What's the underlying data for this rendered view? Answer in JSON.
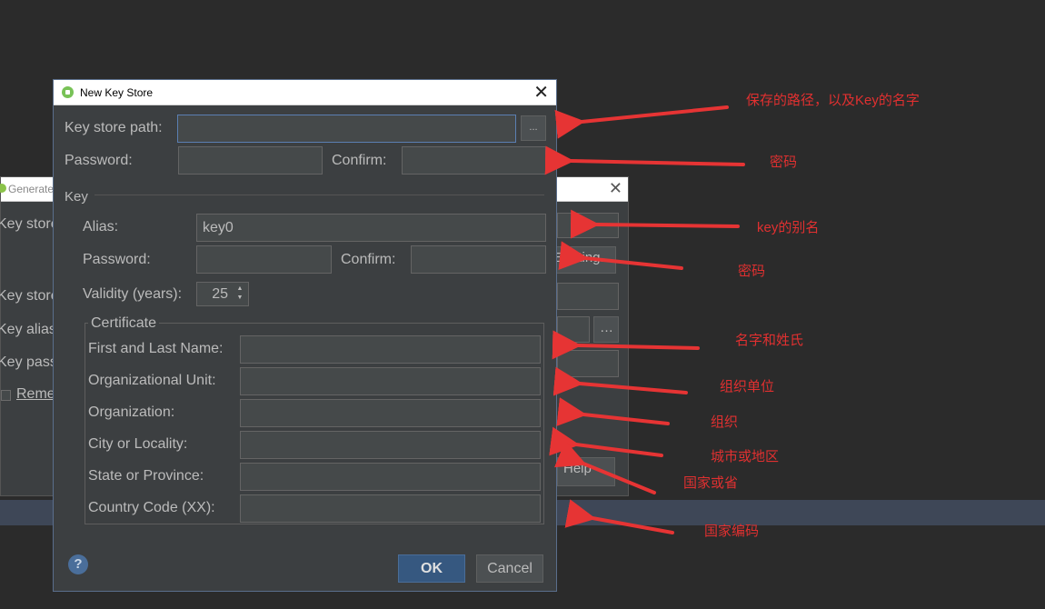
{
  "background_dialog": {
    "title": "Generate",
    "labels": [
      "Key store",
      "Key store",
      "Key alias",
      "Key passw",
      "Reme"
    ],
    "buttons": [
      "Existing...",
      "Help"
    ]
  },
  "dialog": {
    "title": "New Key Store",
    "key_store_path": {
      "label": "Key store path:",
      "value": "",
      "browse": "..."
    },
    "password": {
      "label": "Password:",
      "value": ""
    },
    "confirm": {
      "label": "Confirm:",
      "value": ""
    },
    "key_section": "Key",
    "alias": {
      "label": "Alias:",
      "value": "key0"
    },
    "key_password": {
      "label": "Password:",
      "value": ""
    },
    "key_confirm": {
      "label": "Confirm:",
      "value": ""
    },
    "validity": {
      "label": "Validity (years):",
      "value": "25"
    },
    "certificate": {
      "title": "Certificate",
      "fields": [
        {
          "label": "First and Last Name:",
          "value": ""
        },
        {
          "label": "Organizational Unit:",
          "value": ""
        },
        {
          "label": "Organization:",
          "value": ""
        },
        {
          "label": "City or Locality:",
          "value": ""
        },
        {
          "label": "State or Province:",
          "value": ""
        },
        {
          "label": "Country Code (XX):",
          "value": ""
        }
      ]
    },
    "help": "?",
    "ok": "OK",
    "cancel": "Cancel"
  },
  "annotations": [
    "保存的路径，以及Key的名字",
    "密码",
    "key的别名",
    "密码",
    "名字和姓氏",
    "组织单位",
    "组织",
    "城市或地区",
    "国家或省",
    "国家编码"
  ],
  "colors": {
    "annotation": "#e03030",
    "dialog_bg": "#3c3f41",
    "ok_button": "#365880"
  }
}
